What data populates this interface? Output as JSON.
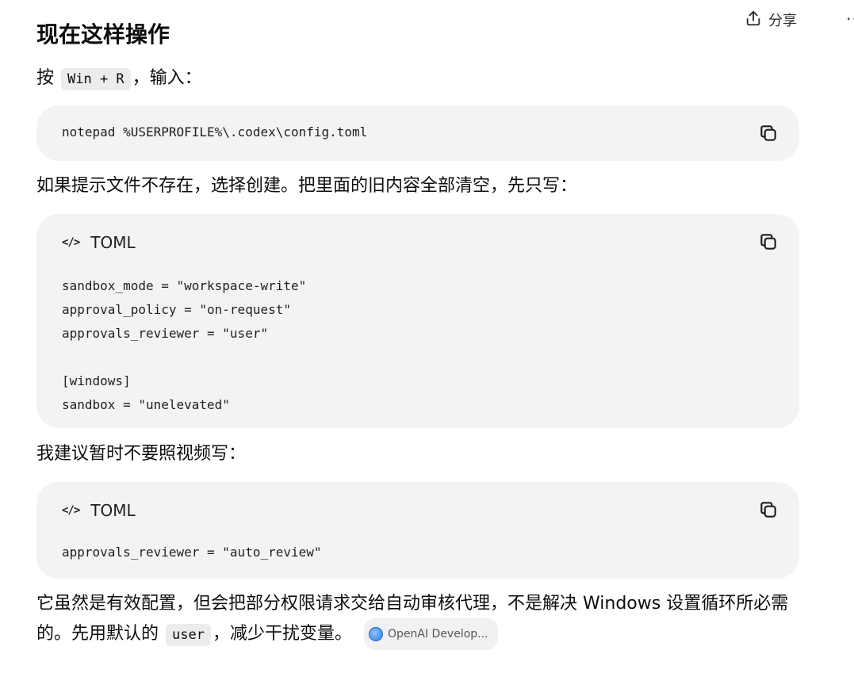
{
  "topbar": {
    "share_label": "分享",
    "more_label": "··"
  },
  "heading": "现在这样操作",
  "step1": {
    "prefix": "按",
    "shortcut": "Win + R",
    "suffix": "，输入："
  },
  "command_block": {
    "code": "notepad %USERPROFILE%\\.codex\\config.toml"
  },
  "step2": "如果提示文件不存在，选择创建。把里面的旧内容全部清空，先只写：",
  "toml_block_1": {
    "lang_icon": "</>",
    "lang": "TOML",
    "lines": [
      "sandbox_mode = \"workspace-write\"",
      "approval_policy = \"on-request\"",
      "approvals_reviewer = \"user\"",
      "",
      "[windows]",
      "sandbox = \"unelevated\""
    ]
  },
  "step3": "我建议暂时不要照视频写：",
  "toml_block_2": {
    "lang_icon": "</>",
    "lang": "TOML",
    "lines": [
      "approvals_reviewer = \"auto_review\""
    ]
  },
  "step4": {
    "text_a": "它虽然是有效配置，但会把部分权限请求交给自动审核代理，不是解决 Windows 设置循环所必需的。先用默认的",
    "inline_code": "user",
    "text_b": "，减少干扰变量。",
    "citation": "OpenAI Develop..."
  },
  "icons": {
    "share": "share-icon",
    "copy": "copy-icon",
    "code": "code-icon",
    "globe": "globe-icon"
  }
}
